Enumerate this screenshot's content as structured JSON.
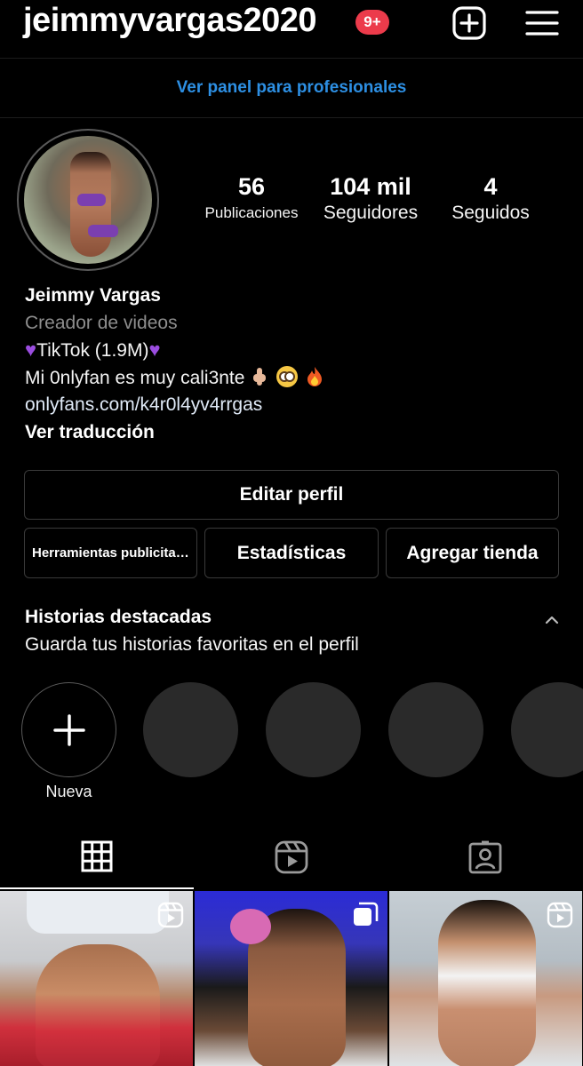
{
  "header": {
    "username": "jeimmyvargas2020",
    "notifications_badge": "9+",
    "new_post_icon": "plus-square-icon",
    "menu_icon": "hamburger-menu-icon"
  },
  "pro_panel": {
    "label": "Ver panel para profesionales"
  },
  "profile": {
    "stats": [
      {
        "value": "56",
        "label": "Publicaciones"
      },
      {
        "value": "104 mil",
        "label": "Seguidores"
      },
      {
        "value": "4",
        "label": "Seguidos"
      }
    ],
    "name": "Jeimmy Vargas",
    "category": "Creador de videos",
    "bio_line1": "TikTok (1.9M)",
    "bio_line2": "Mi 0nlyfan es muy cali3nte",
    "link": "onlyfans.com/k4r0l4yv4rrgas",
    "translate": "Ver traducción"
  },
  "buttons": {
    "edit_profile": "Editar perfil",
    "tools": "Herramientas publicitarias",
    "stats": "Estadísticas",
    "shop": "Agregar tienda"
  },
  "highlights": {
    "title": "Historias destacadas",
    "subtitle": "Guarda tus historias favoritas en el perfil",
    "new_label": "Nueva"
  },
  "tabs": [
    {
      "icon": "grid-icon",
      "active": true
    },
    {
      "icon": "reels-icon",
      "active": false
    },
    {
      "icon": "tagged-icon",
      "active": false
    }
  ],
  "colors": {
    "accent_link": "#2d8fe3",
    "badge_red": "#ec3b4b",
    "heart_purple": "#9b4de0"
  }
}
